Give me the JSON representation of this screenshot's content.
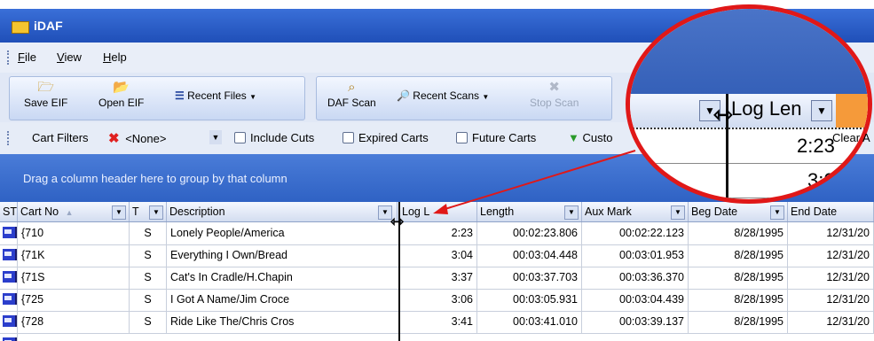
{
  "window": {
    "title": "iDAF"
  },
  "menu": [
    "File",
    "View",
    "Help"
  ],
  "toolbar": {
    "save_eif": "Save EIF",
    "open_eif": "Open EIF",
    "recent_files": "Recent Files",
    "daf_scan": "DAF Scan",
    "recent_scans": "Recent Scans",
    "stop_scan": "Stop Scan"
  },
  "filters": {
    "cart_filters_label": "Cart Filters",
    "cart_filter_value": "<None>",
    "include_cuts": "Include Cuts",
    "expired_carts": "Expired Carts",
    "future_carts": "Future Carts",
    "custom": "Custo",
    "clear": "Clear A"
  },
  "group_panel": {
    "hint": "Drag a column header here to group by that column"
  },
  "columns": [
    "ST",
    "Cart No",
    "T",
    "Description",
    "Log L",
    "Length",
    "Aux Mark",
    "Beg Date",
    "End Date"
  ],
  "rows": [
    {
      "cart": "{710",
      "type": "S",
      "desc": "Lonely People/America",
      "log_len": "2:23",
      "length": "00:02:23.806",
      "aux": "00:02:22.123",
      "beg": "8/28/1995",
      "end": "12/31/20"
    },
    {
      "cart": "{71K",
      "type": "S",
      "desc": "Everything I Own/Bread",
      "log_len": "3:04",
      "length": "00:03:04.448",
      "aux": "00:03:01.953",
      "beg": "8/28/1995",
      "end": "12/31/20"
    },
    {
      "cart": "{71S",
      "type": "S",
      "desc": "Cat's In Cradle/H.Chapin",
      "log_len": "3:37",
      "length": "00:03:37.703",
      "aux": "00:03:36.370",
      "beg": "8/28/1995",
      "end": "12/31/20"
    },
    {
      "cart": "{725",
      "type": "S",
      "desc": "I Got A Name/Jim Croce",
      "log_len": "3:06",
      "length": "00:03:05.931",
      "aux": "00:03:04.439",
      "beg": "8/28/1995",
      "end": "12/31/20"
    },
    {
      "cart": "{728",
      "type": "S",
      "desc": "Ride Like The/Chris Cros",
      "log_len": "3:41",
      "length": "00:03:41.010",
      "aux": "00:03:39.137",
      "beg": "8/28/1995",
      "end": "12/31/20"
    }
  ],
  "magnifier": {
    "header_label": "Log Len",
    "row1_value": "2:23",
    "row2_value": "3:0"
  },
  "colors": {
    "title_bar": "#2a5ccc",
    "group_panel": "#3d6fd0",
    "callout_red": "#e01818",
    "flag_blue": "#2b3ecc"
  },
  "icons": {
    "save": "save-icon",
    "open": "folder-open-icon",
    "recent": "list-icon",
    "scan": "magnifier-icon",
    "binoculars": "binoculars-icon",
    "stop": "stop-icon",
    "flag": "flag-icon",
    "resize": "column-resize-cursor-icon"
  }
}
